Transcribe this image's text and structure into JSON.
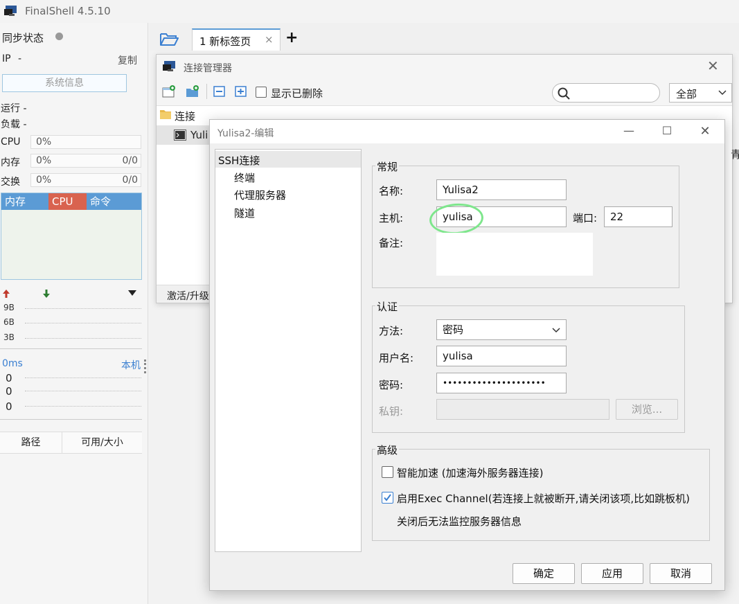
{
  "app": {
    "title": "FinalShell 4.5.10"
  },
  "sidebar": {
    "sync_label": "同步状态",
    "ip_label": "IP",
    "ip_value": "-",
    "copy_label": "复制",
    "sysinfo_button": "系统信息",
    "run_label": "运行 -",
    "load_label": "负载 -",
    "cpu_label": "CPU",
    "cpu_value": "0%",
    "mem_label": "内存",
    "mem_value": "0%",
    "mem_count": "0/0",
    "swap_label": "交换",
    "swap_value": "0%",
    "swap_count": "0/0",
    "proc_headers": [
      "内存",
      "CPU",
      "命令"
    ],
    "net_ticks": [
      "9B",
      "6B",
      "3B"
    ],
    "latency_label": "0ms",
    "local_label": "本机",
    "latency_values": [
      "0",
      "0",
      "0"
    ],
    "disk_headers": [
      "路径",
      "可用/大小"
    ]
  },
  "tabs": {
    "active_tab": "1 新标签页",
    "close": "×",
    "add": "+"
  },
  "conn_manager": {
    "title": "连接管理器",
    "show_deleted": "显示已删除",
    "filter_value": "全部",
    "folder": "连接",
    "item": "Yuli",
    "status": "激活/升级",
    "right_edge": "青"
  },
  "editor": {
    "title": "Yulisa2-编辑",
    "tree": [
      "SSH连接",
      "终端",
      "代理服务器",
      "隧道"
    ],
    "general": {
      "legend": "常规",
      "name_label": "名称:",
      "name_value": "Yulisa2",
      "host_label": "主机:",
      "host_value": "yulisa",
      "port_label": "端口:",
      "port_value": "22",
      "note_label": "备注:"
    },
    "auth": {
      "legend": "认证",
      "method_label": "方法:",
      "method_value": "密码",
      "user_label": "用户名:",
      "user_value": "yulisa",
      "pass_label": "密码:",
      "pass_value": "•••••••••••••••••••••",
      "key_label": "私钥:",
      "browse": "浏览..."
    },
    "advanced": {
      "legend": "高级",
      "smart_accel": "智能加速 (加速海外服务器连接)",
      "smart_accel_checked": false,
      "exec_channel": "启用Exec Channel(若连接上就被断开,请关闭该项,比如跳板机)",
      "exec_channel_checked": true,
      "exec_note": "关闭后无法监控服务器信息"
    },
    "buttons": {
      "ok": "确定",
      "apply": "应用",
      "cancel": "取消"
    }
  },
  "colors": {
    "accent": "#5b9bd5",
    "cpu_header": "#d9634f",
    "highlight": "#7ee68c"
  }
}
